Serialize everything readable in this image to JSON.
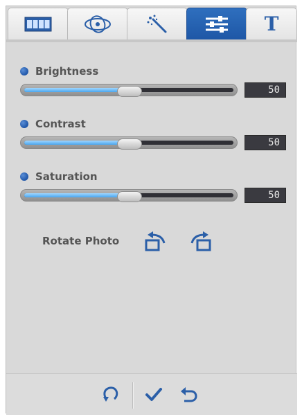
{
  "tabs": [
    {
      "icon": "film-strip-icon",
      "active": false
    },
    {
      "icon": "orbit-icon",
      "active": false
    },
    {
      "icon": "magic-wand-icon",
      "active": false
    },
    {
      "icon": "sliders-icon",
      "active": true
    },
    {
      "label": "T",
      "icon": "text-icon",
      "active": false
    }
  ],
  "controls": {
    "brightness": {
      "label": "Brightness",
      "value": "50"
    },
    "contrast": {
      "label": "Contrast",
      "value": "50"
    },
    "saturation": {
      "label": "Saturation",
      "value": "50"
    }
  },
  "rotate": {
    "label": "Rotate Photo",
    "left_icon": "rotate-left-icon",
    "right_icon": "rotate-right-icon"
  },
  "bottom": {
    "reset_icon": "reset-icon",
    "apply_icon": "checkmark-icon",
    "undo_icon": "undo-icon"
  },
  "colors": {
    "accent_blue": "#2f6fbe",
    "panel_bg": "#d9d9d9",
    "value_box_bg": "#3a3a40"
  }
}
